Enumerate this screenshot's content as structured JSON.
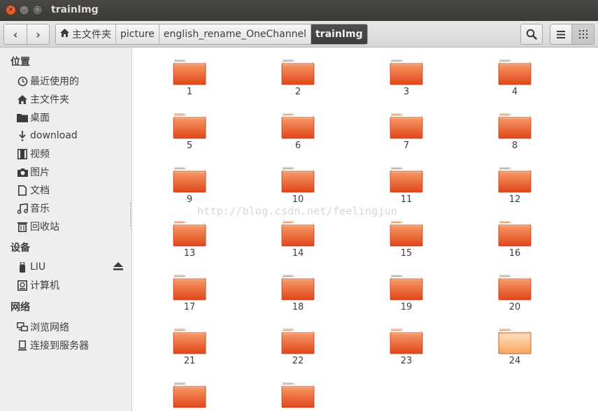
{
  "window": {
    "title": "trainImg"
  },
  "breadcrumbs": [
    {
      "label": "主文件夹",
      "icon": "home-icon"
    },
    {
      "label": "picture"
    },
    {
      "label": "english_rename_OneChannel"
    },
    {
      "label": "trainImg"
    }
  ],
  "sidebar": {
    "sections": [
      {
        "title": "位置",
        "items": [
          {
            "label": "最近使用的",
            "icon": "clock-icon"
          },
          {
            "label": "主文件夹",
            "icon": "home-icon"
          },
          {
            "label": "桌面",
            "icon": "folder-icon"
          },
          {
            "label": "download",
            "icon": "download-icon"
          },
          {
            "label": "视频",
            "icon": "film-icon"
          },
          {
            "label": "图片",
            "icon": "camera-icon"
          },
          {
            "label": "文档",
            "icon": "document-icon"
          },
          {
            "label": "音乐",
            "icon": "music-icon"
          },
          {
            "label": "回收站",
            "icon": "trash-icon"
          }
        ]
      },
      {
        "title": "设备",
        "items": [
          {
            "label": "LIU",
            "icon": "usb-icon"
          },
          {
            "label": "计算机",
            "icon": "drive-icon"
          }
        ]
      },
      {
        "title": "网络",
        "items": [
          {
            "label": "浏览网络",
            "icon": "network-icon"
          },
          {
            "label": "连接到服务器",
            "icon": "server-icon"
          }
        ]
      }
    ]
  },
  "folders": [
    "1",
    "2",
    "3",
    "4",
    "5",
    "6",
    "7",
    "8",
    "9",
    "10",
    "11",
    "12",
    "13",
    "14",
    "15",
    "16",
    "17",
    "18",
    "19",
    "20",
    "21",
    "22",
    "23",
    "24",
    "",
    ""
  ],
  "watermark": "http://blog.csdn.net/feelingjun",
  "colors": {
    "folder_orange": "#e8592a",
    "folder_light": "#f7a872",
    "selected_crumb": "#3d3d3b"
  }
}
